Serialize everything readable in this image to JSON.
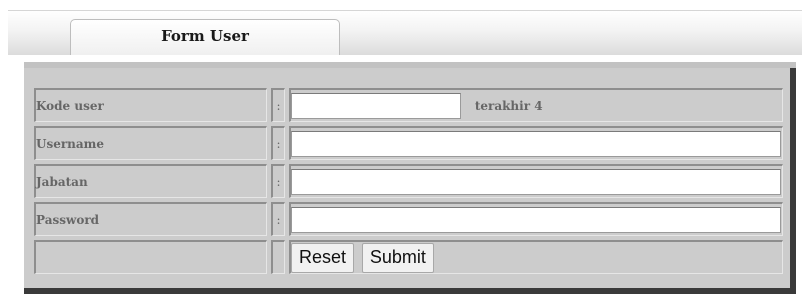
{
  "tab": {
    "title": "Form User"
  },
  "form": {
    "rows": [
      {
        "label": "Kode user",
        "separator": ":",
        "value": "",
        "hint": "terakhir 4"
      },
      {
        "label": "Username",
        "separator": ":",
        "value": ""
      },
      {
        "label": "Jabatan",
        "separator": ":",
        "value": ""
      },
      {
        "label": "Password",
        "separator": ":",
        "value": ""
      }
    ],
    "buttons": {
      "reset_label": "Reset",
      "submit_label": "Submit"
    }
  }
}
